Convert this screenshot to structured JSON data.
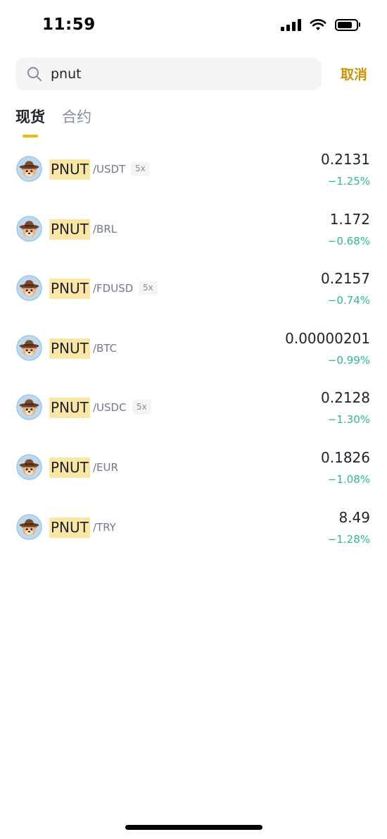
{
  "status_bar": {
    "time": "11:59",
    "icons": [
      "cellular-signal-icon",
      "wifi-icon",
      "battery-icon"
    ]
  },
  "search": {
    "value": "pnut",
    "icon": "search-icon",
    "cancel_label": "取消"
  },
  "tabs": [
    {
      "label": "现货",
      "active": true
    },
    {
      "label": "合约",
      "active": false
    }
  ],
  "colors": {
    "accent": "#f0b90b",
    "cancel": "#c99400",
    "highlight": "#fae7a5",
    "positive": "#2ebd85",
    "text": "#1e2329",
    "muted": "#707a8a"
  },
  "pairs": [
    {
      "base": "PNUT",
      "quote": "/USDT",
      "leverage": "5x",
      "price": "0.2131",
      "change": "−1.25%"
    },
    {
      "base": "PNUT",
      "quote": "/BRL",
      "leverage": "",
      "price": "1.172",
      "change": "−0.68%"
    },
    {
      "base": "PNUT",
      "quote": "/FDUSD",
      "leverage": "5x",
      "price": "0.2157",
      "change": "−0.74%"
    },
    {
      "base": "PNUT",
      "quote": "/BTC",
      "leverage": "",
      "price": "0.00000201",
      "change": "−0.99%"
    },
    {
      "base": "PNUT",
      "quote": "/USDC",
      "leverage": "5x",
      "price": "0.2128",
      "change": "−1.30%"
    },
    {
      "base": "PNUT",
      "quote": "/EUR",
      "leverage": "",
      "price": "0.1826",
      "change": "−1.08%"
    },
    {
      "base": "PNUT",
      "quote": "/TRY",
      "leverage": "",
      "price": "8.49",
      "change": "−1.28%"
    }
  ]
}
